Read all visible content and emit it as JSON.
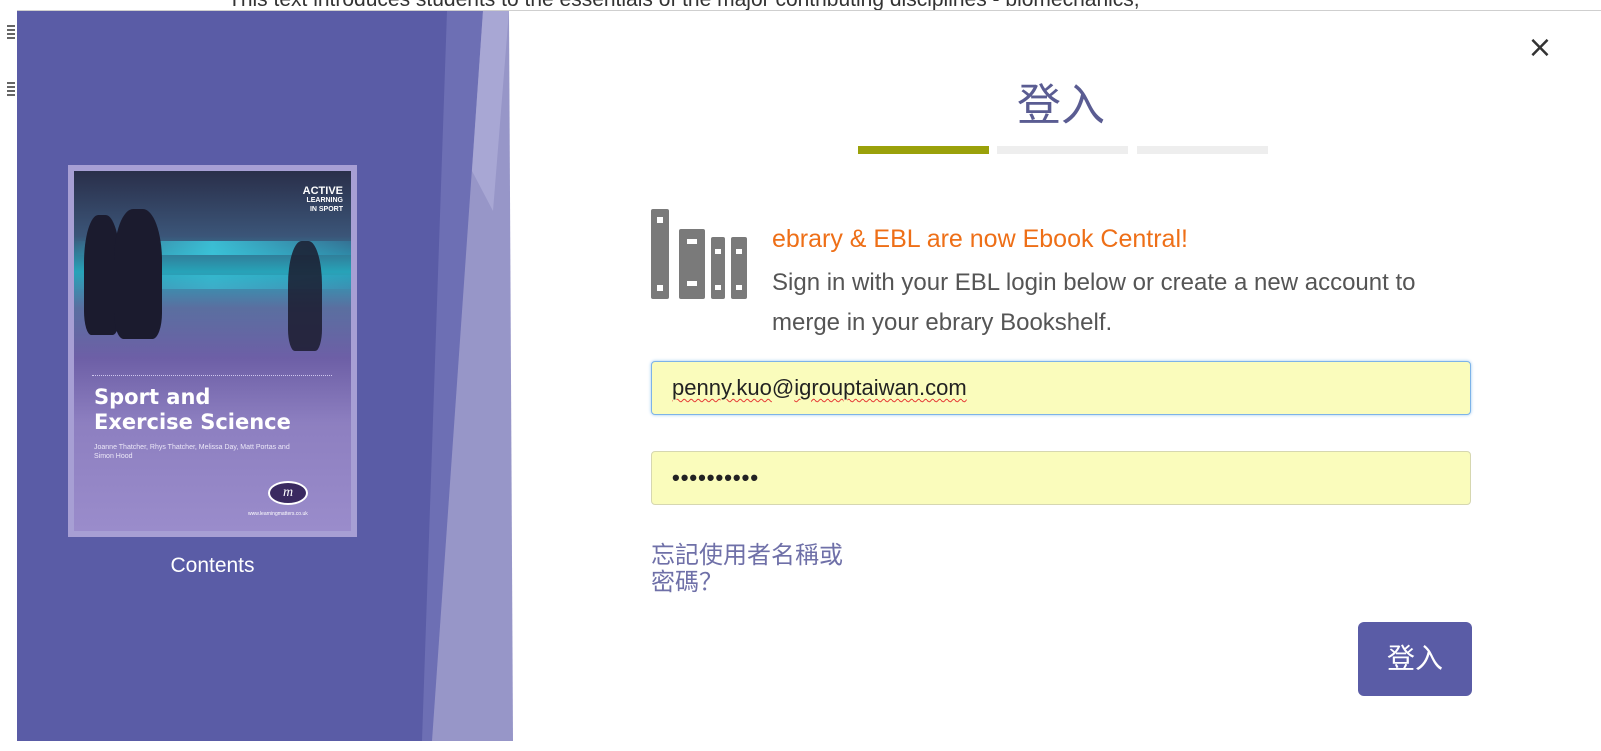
{
  "background": {
    "partial_text": "This text introduces students to the essentials of the major contributing disciplines - biomechanics,"
  },
  "modal": {
    "close_icon": "×",
    "title": "登入",
    "progress": {
      "steps": 3,
      "active_step": 1
    },
    "notice": {
      "icon": "books-icon",
      "heading": "ebrary & EBL are now Ebook Central!",
      "body": "Sign in with your EBL login below or create a new account to merge in your ebrary Bookshelf."
    },
    "email_field": {
      "value_prefix": "penny.kuo",
      "value_suffix": "@igrouptaiwan.com"
    },
    "password_field": {
      "value": "••••••••••"
    },
    "forgot_link": "忘記使用者名稱或密碼？",
    "submit_label": "登入",
    "colors": {
      "accent": "#5a5ca6",
      "heading_orange": "#ee6f17",
      "progress_active": "#9aa10a",
      "left_panel": "#5a5ca6"
    }
  },
  "book": {
    "series_badge_1": "ACTIVE",
    "series_badge_2": "LEARNING",
    "series_badge_3": "IN SPORT",
    "title_line_1": "Sport and",
    "title_line_2": "Exercise Science",
    "authors": "Joanne Thatcher, Rhys Thatcher, Melissa Day, Matt Portas and Simon Hood",
    "publisher_logo": "m",
    "publisher_url": "www.learningmatters.co.uk",
    "contents_label": "Contents"
  }
}
